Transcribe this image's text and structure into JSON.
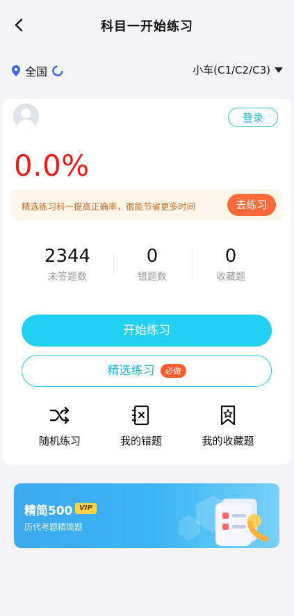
{
  "header": {
    "title": "科目一开始练习"
  },
  "location": {
    "label": "全国"
  },
  "car_type": {
    "label": "小车(C1/C2/C3)"
  },
  "card": {
    "login_label": "登录",
    "accuracy": "0.0%",
    "tip_text": "精选练习科一提高正确率，很能节省更多时间",
    "tip_button": "去练习",
    "stats": [
      {
        "value": "2344",
        "label": "未答题数"
      },
      {
        "value": "0",
        "label": "错题数"
      },
      {
        "value": "0",
        "label": "收藏题"
      }
    ],
    "start_button": "开始练习",
    "selected_button": "精选练习",
    "selected_badge": "必做",
    "tools": [
      {
        "label": "随机练习",
        "icon": "shuffle-icon"
      },
      {
        "label": "我的错题",
        "icon": "wrong-book-icon"
      },
      {
        "label": "我的收藏题",
        "icon": "bookmark-star-icon"
      }
    ]
  },
  "promo": {
    "title": "精简500",
    "badge": "VIP",
    "subtitle": "历代考题精简题"
  },
  "colors": {
    "accent": "#22d1f1",
    "accuracy_red": "#f01818",
    "orange": "#ff6a3b",
    "promo_blue": "#3cb6f4"
  }
}
